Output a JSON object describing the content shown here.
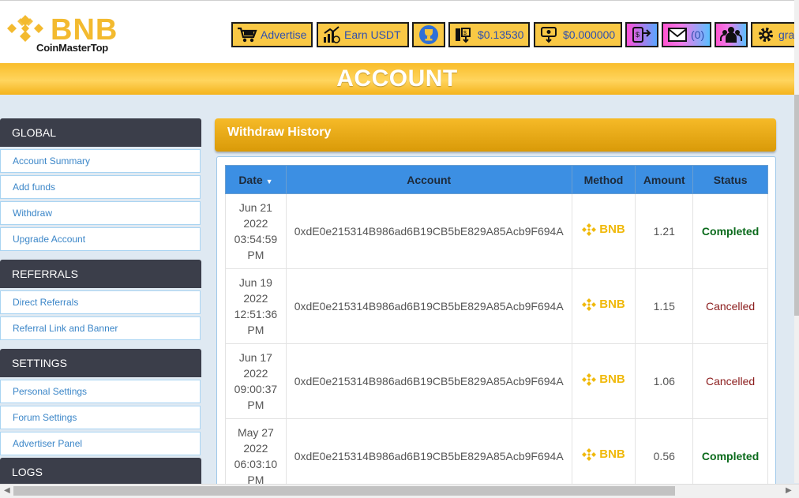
{
  "header": {
    "brand": "BNB",
    "sub": "CoinMasterTop",
    "buttons": {
      "advertise": "Advertise",
      "earn": "Earn USDT",
      "balance1": "$0.13530",
      "balance2": "$0.000000",
      "messages": "(0)",
      "user": "gra"
    },
    "page_title": "ACCOUNT"
  },
  "sidebar": {
    "global": {
      "title": "GLOBAL",
      "items": [
        "Account Summary",
        "Add funds",
        "Withdraw",
        "Upgrade Account"
      ]
    },
    "referrals": {
      "title": "REFERRALS",
      "items": [
        "Direct Referrals",
        "Referral Link and Banner"
      ]
    },
    "settings": {
      "title": "SETTINGS",
      "items": [
        "Personal Settings",
        "Forum Settings",
        "Advertiser Panel"
      ]
    },
    "logs": {
      "title": "LOGS"
    }
  },
  "main": {
    "panel_title": "Withdraw History",
    "columns": {
      "date": "Date",
      "account": "Account",
      "method": "Method",
      "amount": "Amount",
      "status": "Status"
    },
    "method_label": "BNB",
    "rows": [
      {
        "d1": "Jun 21",
        "d2": "2022",
        "d3": "03:54:59",
        "d4": "PM",
        "account": "0xdE0e215314B986ad6B19CB5bE829A85Acb9F694A",
        "amount": "1.21",
        "status": "Completed"
      },
      {
        "d1": "Jun 19",
        "d2": "2022",
        "d3": "12:51:36",
        "d4": "PM",
        "account": "0xdE0e215314B986ad6B19CB5bE829A85Acb9F694A",
        "amount": "1.15",
        "status": "Cancelled"
      },
      {
        "d1": "Jun 17",
        "d2": "2022",
        "d3": "09:00:37",
        "d4": "PM",
        "account": "0xdE0e215314B986ad6B19CB5bE829A85Acb9F694A",
        "amount": "1.06",
        "status": "Cancelled"
      },
      {
        "d1": "May 27",
        "d2": "2022",
        "d3": "06:03:10",
        "d4": "PM",
        "account": "0xdE0e215314B986ad6B19CB5bE829A85Acb9F694A",
        "amount": "0.56",
        "status": "Completed"
      }
    ]
  },
  "colors": {
    "accent": "#f9c845",
    "header_blue": "#3c8fe3",
    "sidebar_dark": "#3b3e4a",
    "completed": "#0a6a1b",
    "cancelled": "#8b1c1c"
  }
}
